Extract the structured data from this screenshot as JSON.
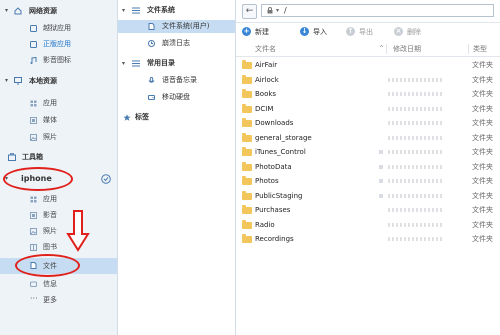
{
  "sidebar": {
    "groups": [
      {
        "label": "网络资源",
        "items": [
          {
            "label": "越狱应用"
          },
          {
            "label": "正版应用"
          },
          {
            "label": "影音图标"
          }
        ]
      },
      {
        "label": "本地资源",
        "items": [
          {
            "label": "应用"
          },
          {
            "label": "媒体"
          },
          {
            "label": "照片"
          }
        ]
      }
    ],
    "toolbox_label": "工具箱",
    "device": {
      "name": "iphone",
      "items": [
        {
          "label": "应用"
        },
        {
          "label": "影音"
        },
        {
          "label": "照片"
        },
        {
          "label": "图书"
        },
        {
          "label": "文件"
        },
        {
          "label": "信息"
        },
        {
          "label": "更多"
        }
      ]
    }
  },
  "tree": {
    "filesystem_header": "文件系统",
    "filesystem_items": [
      {
        "label": "文件系统(用户)"
      },
      {
        "label": "崩溃日志"
      }
    ],
    "common_header": "常用目录",
    "common_items": [
      {
        "label": "语音备忘录"
      },
      {
        "label": "移动硬盘"
      }
    ],
    "bookmarks_label": "标签"
  },
  "address": {
    "path": "/"
  },
  "toolbar": {
    "new_label": "新建",
    "import_label": "导入",
    "export_label": "导出",
    "delete_label": "删除"
  },
  "columns": {
    "name": "文件名",
    "modified": "修改日期",
    "type": "类型"
  },
  "files": [
    {
      "name": "AirFair",
      "type": "文件夹"
    },
    {
      "name": "Airlock",
      "type": "文件夹"
    },
    {
      "name": "Books",
      "type": "文件夹"
    },
    {
      "name": "DCIM",
      "type": "文件夹"
    },
    {
      "name": "Downloads",
      "type": "文件夹"
    },
    {
      "name": "general_storage",
      "type": "文件夹"
    },
    {
      "name": "iTunes_Control",
      "type": "文件夹"
    },
    {
      "name": "PhotoData",
      "type": "文件夹"
    },
    {
      "name": "Photos",
      "type": "文件夹"
    },
    {
      "name": "PublicStaging",
      "type": "文件夹"
    },
    {
      "name": "Purchases",
      "type": "文件夹"
    },
    {
      "name": "Radio",
      "type": "文件夹"
    },
    {
      "name": "Recordings",
      "type": "文件夹"
    }
  ],
  "colors": {
    "selection": "#c6dcf2",
    "link_blue": "#1e73c8",
    "folder": "#f2c65a",
    "annotation_red": "#e0211b"
  }
}
